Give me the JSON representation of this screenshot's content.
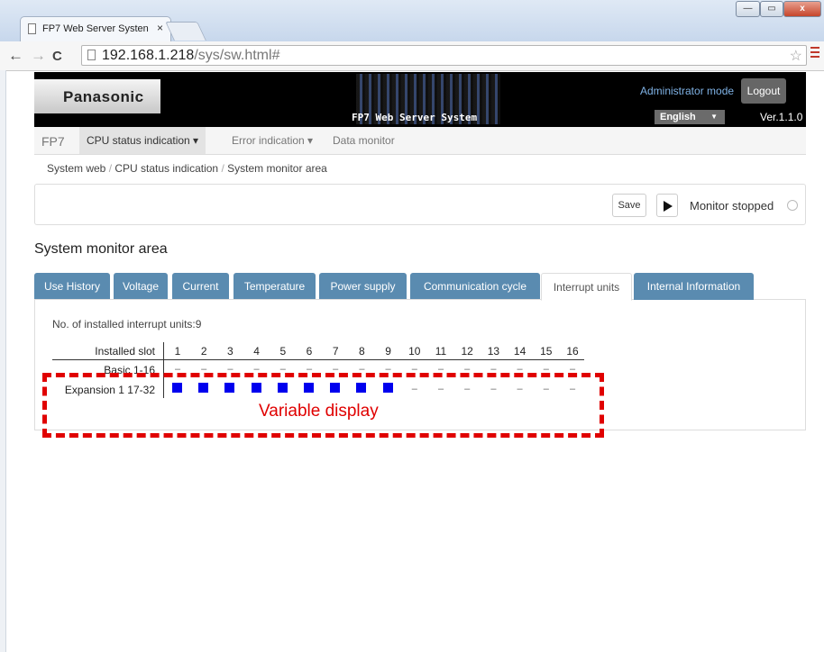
{
  "browser": {
    "tab_title": "FP7 Web Server Systen",
    "tab_close": "×",
    "window_controls": {
      "minimize": "—",
      "maximize": "▭",
      "close": "x"
    },
    "nav": {
      "back": "←",
      "forward": "→",
      "reload": "C"
    },
    "url_host": "192.168.1.218",
    "url_path": "/sys/sw.html#",
    "star": "☆"
  },
  "header": {
    "logo": "Panasonic",
    "system_title": "FP7 Web Server System",
    "mode": "Administrator mode",
    "logout": "Logout",
    "language": "English",
    "language_caret": "▼",
    "version": "Ver.1.1.0"
  },
  "menu": {
    "brand": "FP7",
    "items": [
      {
        "label": "CPU status indication ▾"
      },
      {
        "label": "Error indication ▾"
      },
      {
        "label": "Data monitor"
      }
    ]
  },
  "breadcrumb": [
    "System web",
    "CPU status indication",
    "System monitor area"
  ],
  "toolbar": {
    "save": "Save",
    "status": "Monitor stopped"
  },
  "section_title": "System monitor area",
  "tabs": [
    {
      "label": "Use History"
    },
    {
      "label": "Voltage"
    },
    {
      "label": "Current"
    },
    {
      "label": "Temperature"
    },
    {
      "label": "Power supply"
    },
    {
      "label": "Communication cycle"
    },
    {
      "label": "Interrupt units",
      "active": true
    },
    {
      "label": "Internal Information"
    }
  ],
  "interrupt": {
    "count_text": "No. of installed interrupt units:9",
    "header_label": "Installed slot",
    "slots": [
      "1",
      "2",
      "3",
      "4",
      "5",
      "6",
      "7",
      "8",
      "9",
      "10",
      "11",
      "12",
      "13",
      "14",
      "15",
      "16"
    ],
    "rows": [
      {
        "label": "Basic 1-16",
        "installed": []
      },
      {
        "label": "Expansion 1 17-32",
        "installed": [
          1,
          2,
          3,
          4,
          5,
          6,
          7,
          8,
          9
        ]
      }
    ],
    "empty_mark": "–"
  },
  "annotation": "Variable display"
}
